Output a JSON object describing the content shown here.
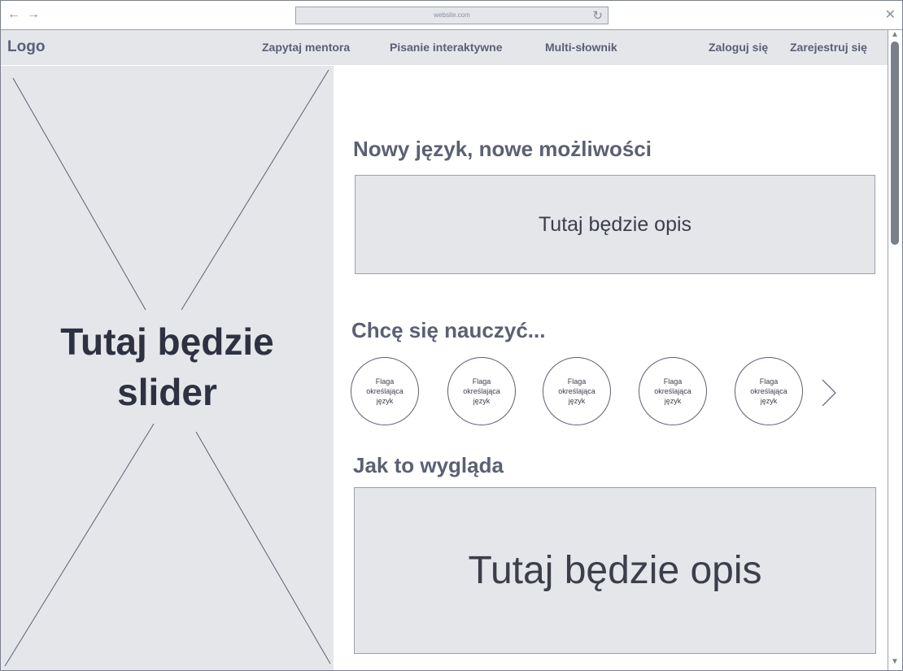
{
  "browser": {
    "url": "website.com"
  },
  "nav": {
    "logo": "Logo",
    "links": [
      "Zapytaj mentora",
      "Pisanie interaktywne",
      "Multi-słownik"
    ],
    "login": "Zaloguj się",
    "register": "Zarejestruj się"
  },
  "slider": {
    "line1": "Tutaj będzie",
    "line2": "slider"
  },
  "main": {
    "heading1": "Nowy język, nowe możliwości",
    "desc1": "Tutaj będzie opis",
    "heading2": "Chcę się nauczyć...",
    "flags": [
      [
        "Flaga",
        "określająca",
        "język"
      ],
      [
        "Flaga",
        "określająca",
        "język"
      ],
      [
        "Flaga",
        "określająca",
        "język"
      ],
      [
        "Flaga",
        "określająca",
        "język"
      ],
      [
        "Flaga",
        "określająca",
        "język"
      ]
    ],
    "heading3": "Jak to wygląda",
    "desc2": "Tutaj będzie opis"
  },
  "colors": {
    "placeholder_bg": "#e4e6ea",
    "text_heading": "#5b6072",
    "border": "#9aa0ab"
  }
}
